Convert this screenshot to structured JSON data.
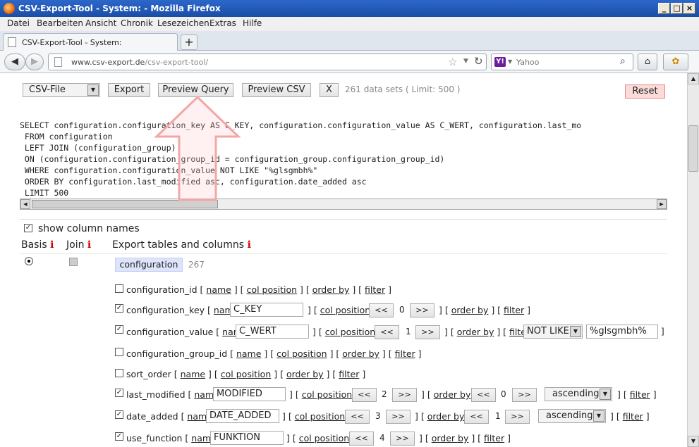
{
  "window": {
    "title": "CSV-Export-Tool - System: - Mozilla Firefox",
    "controls": [
      "_",
      "□",
      "×"
    ]
  },
  "menu": [
    "Datei",
    "Bearbeiten",
    "Ansicht",
    "Chronik",
    "Lesezeichen",
    "Extras",
    "Hilfe"
  ],
  "tab": {
    "label": "CSV-Export-Tool - System:",
    "new_tab": "+"
  },
  "nav": {
    "url_host": "www.csv-export.de",
    "url_path": "/csv-export-tool/",
    "search_placeholder": "Yahoo",
    "search_engine": "Y!"
  },
  "toolbar": {
    "format_select": "CSV-File",
    "export_label": "Export",
    "preview_query_label": "Preview Query",
    "preview_csv_label": "Preview CSV",
    "x_label": "X",
    "status": "261 data sets ( Limit: 500 )",
    "reset_label": "Reset"
  },
  "sql": [
    "SELECT configuration.configuration_key AS C_KEY, configuration.configuration_value AS C_WERT, configuration.last_mo",
    " FROM configuration",
    " LEFT JOIN (configuration_group)",
    " ON (configuration.configuration_group_id = configuration_group.configuration_group_id)",
    " WHERE configuration.configuration_value NOT LIKE \"%glsgmbh%\"",
    " ORDER BY configuration.last_modified asc, configuration.date_added asc",
    " LIMIT 500"
  ],
  "options": {
    "show_column_names": "show column names"
  },
  "headers": {
    "basis": "Basis",
    "join": "Join",
    "export": "Export tables and columns",
    "info": "i"
  },
  "table": {
    "name": "configuration",
    "count": "267"
  },
  "labels": {
    "name": "name",
    "col_position": "col position",
    "order_by": "order by",
    "filter": "filter",
    "prev": "<<",
    "next": ">>"
  },
  "columns": [
    {
      "name": "configuration_id",
      "checked": false
    },
    {
      "name": "configuration_key",
      "checked": true,
      "alias": "C_KEY",
      "pos": "0"
    },
    {
      "name": "configuration_value",
      "checked": true,
      "alias": "C_WERT",
      "pos": "1",
      "filter_op": "NOT LIKE",
      "filter_val": "%glsgmbh%"
    },
    {
      "name": "configuration_group_id",
      "checked": false
    },
    {
      "name": "sort_order",
      "checked": false
    },
    {
      "name": "last_modified",
      "checked": true,
      "alias": "MODIFIED",
      "pos": "2",
      "order_pos": "0",
      "order_dir": "ascending"
    },
    {
      "name": "date_added",
      "checked": true,
      "alias": "DATE_ADDED",
      "pos": "3",
      "order_pos": "1",
      "order_dir": "ascending"
    },
    {
      "name": "use_function",
      "checked": true,
      "alias": "FUNKTION",
      "pos": "4"
    }
  ]
}
